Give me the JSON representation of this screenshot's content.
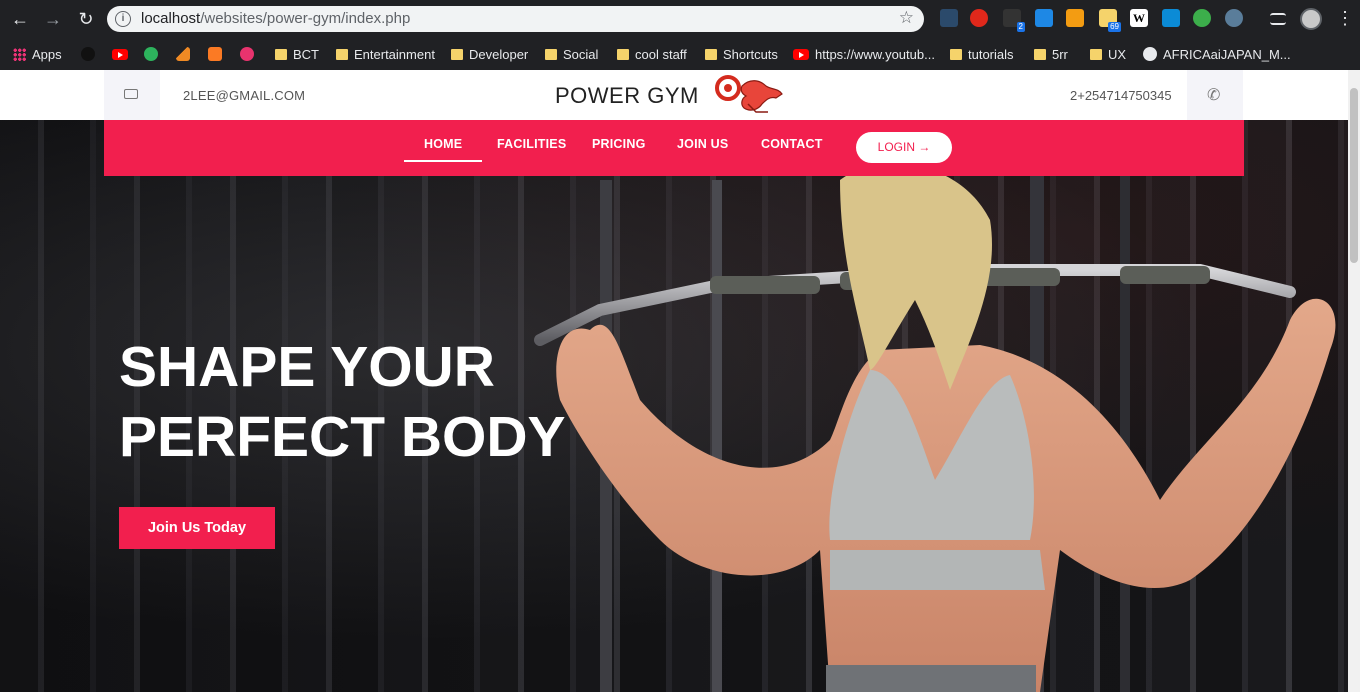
{
  "browser": {
    "url_host": "localhost",
    "url_path": "/websites/power-gym/index.php",
    "extension_badges": {
      "ext_2": "2",
      "ext_69": "69"
    }
  },
  "bookmarks": [
    {
      "label": "Apps",
      "icon": "apps-grid-icon"
    },
    {
      "label": "",
      "icon": "github-icon"
    },
    {
      "label": "",
      "icon": "youtube-icon"
    },
    {
      "label": "",
      "icon": "ft-icon"
    },
    {
      "label": "",
      "icon": "mountain-icon"
    },
    {
      "label": "",
      "icon": "xampp-icon"
    },
    {
      "label": "",
      "icon": "circle-c-icon"
    },
    {
      "label": "BCT",
      "icon": "folder-icon"
    },
    {
      "label": "Entertainment",
      "icon": "folder-icon"
    },
    {
      "label": "Developer",
      "icon": "folder-icon"
    },
    {
      "label": "Social",
      "icon": "folder-icon"
    },
    {
      "label": "cool staff",
      "icon": "folder-icon"
    },
    {
      "label": "Shortcuts",
      "icon": "folder-icon"
    },
    {
      "label": "https://www.youtub...",
      "icon": "youtube-icon"
    },
    {
      "label": "tutorials",
      "icon": "folder-icon"
    },
    {
      "label": "5rr",
      "icon": "folder-icon"
    },
    {
      "label": "UX",
      "icon": "folder-icon"
    },
    {
      "label": "AFRICAaiJAPAN_M...",
      "icon": "globe-icon"
    }
  ],
  "site": {
    "email": "2LEE@GMAIL.COM",
    "brand": "POWER GYM",
    "phone": "2+254714750345",
    "nav": {
      "home": "HOME",
      "facilities": "FACILITIES",
      "pricing": "PRICING",
      "join": "JOIN US",
      "contact": "CONTACT",
      "login": "LOGIN →"
    },
    "hero": {
      "line1": "SHAPE YOUR",
      "line2": "PERFECT BODY",
      "cta": "Join Us Today"
    }
  },
  "colors": {
    "accent": "#f21f4e",
    "chrome": "#202124"
  }
}
